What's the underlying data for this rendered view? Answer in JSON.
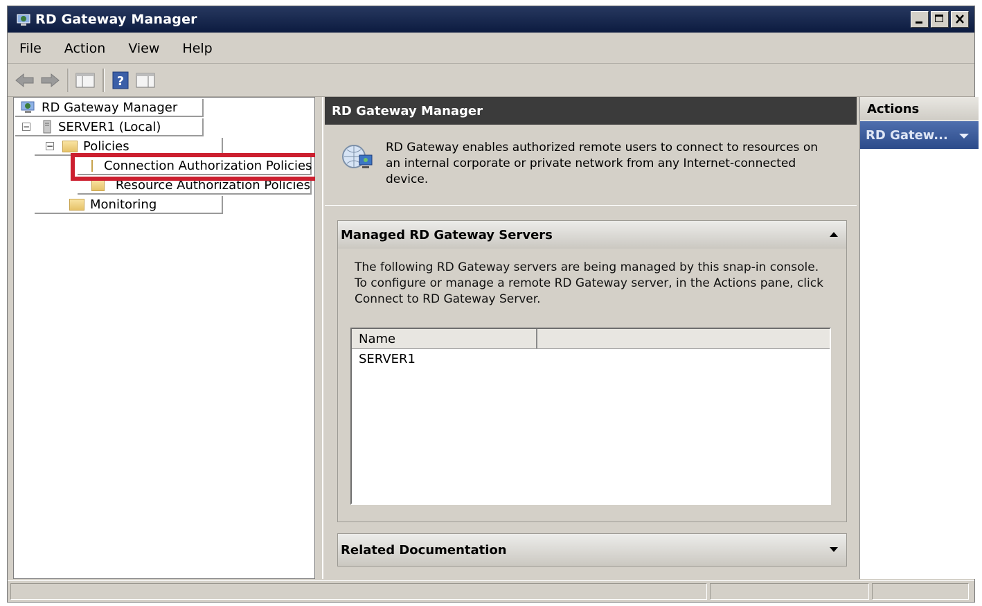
{
  "window": {
    "title": "RD Gateway Manager"
  },
  "menu": [
    "File",
    "Action",
    "View",
    "Help"
  ],
  "toolbar": {
    "icons": [
      "back-arrow-icon",
      "forward-arrow-icon",
      "show-hide-console-tree-icon",
      "help-icon",
      "show-hide-action-pane-icon"
    ]
  },
  "tree": {
    "root": "RD Gateway Manager",
    "server": "SERVER1 (Local)",
    "policies": "Policies",
    "cap": "Connection Authorization Policies",
    "rap": "Resource Authorization Policies",
    "monitoring": "Monitoring",
    "expander_symbol": "−"
  },
  "center": {
    "header": "RD Gateway Manager",
    "intro": "RD Gateway enables authorized remote users to connect to resources on an internal corporate or private network from any Internet-connected device.",
    "managed": {
      "title": "Managed RD Gateway Servers",
      "description": "The following RD Gateway servers are being managed by this snap-in console. To configure or manage a remote RD Gateway server, in the Actions pane, click Connect to RD Gateway Server.",
      "columns": [
        "Name",
        ""
      ],
      "rows": [
        "SERVER1"
      ]
    },
    "related": {
      "title": "Related Documentation"
    }
  },
  "actions": {
    "header": "Actions",
    "item": "RD Gatew..."
  },
  "colors": {
    "title_bar": "#0c1b40",
    "highlight": "#cc1f2f",
    "action_item": "#2c4b8a",
    "center_header": "#3b3b3b"
  }
}
